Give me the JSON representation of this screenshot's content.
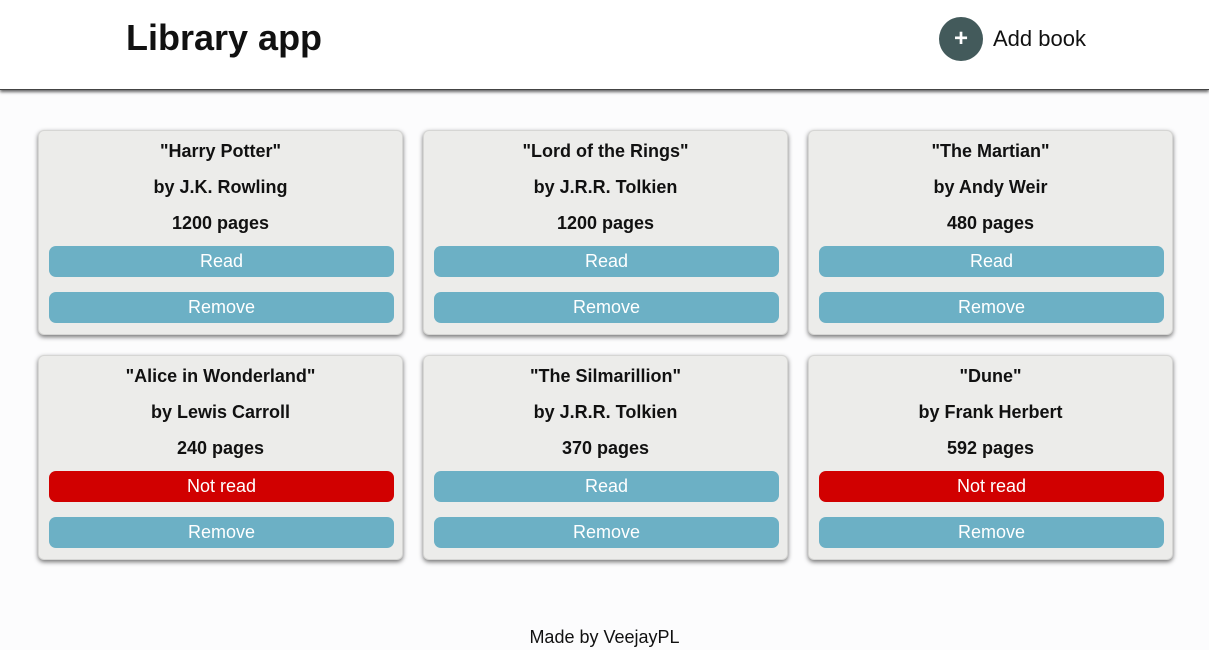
{
  "header": {
    "title": "Library app",
    "add_icon": "+",
    "add_label": "Add book"
  },
  "colors": {
    "accent": "#435a5b",
    "read_button": "#6cb0c5",
    "not_read_button": "#d10000",
    "card_background": "#ececea"
  },
  "books": [
    {
      "title": "\"Harry Potter\"",
      "author": "by J.K. Rowling",
      "pages": "1200 pages",
      "status": "Read",
      "read": true,
      "remove_label": "Remove"
    },
    {
      "title": "\"Lord of the Rings\"",
      "author": "by J.R.R. Tolkien",
      "pages": "1200 pages",
      "status": "Read",
      "read": true,
      "remove_label": "Remove"
    },
    {
      "title": "\"The Martian\"",
      "author": "by Andy Weir",
      "pages": "480 pages",
      "status": "Read",
      "read": true,
      "remove_label": "Remove"
    },
    {
      "title": "\"Alice in Wonderland\"",
      "author": "by Lewis Carroll",
      "pages": "240 pages",
      "status": "Not read",
      "read": false,
      "remove_label": "Remove"
    },
    {
      "title": "\"The Silmarillion\"",
      "author": "by J.R.R. Tolkien",
      "pages": "370 pages",
      "status": "Read",
      "read": true,
      "remove_label": "Remove"
    },
    {
      "title": "\"Dune\"",
      "author": "by Frank Herbert",
      "pages": "592 pages",
      "status": "Not read",
      "read": false,
      "remove_label": "Remove"
    }
  ],
  "footer": {
    "text": "Made by VeejayPL"
  }
}
